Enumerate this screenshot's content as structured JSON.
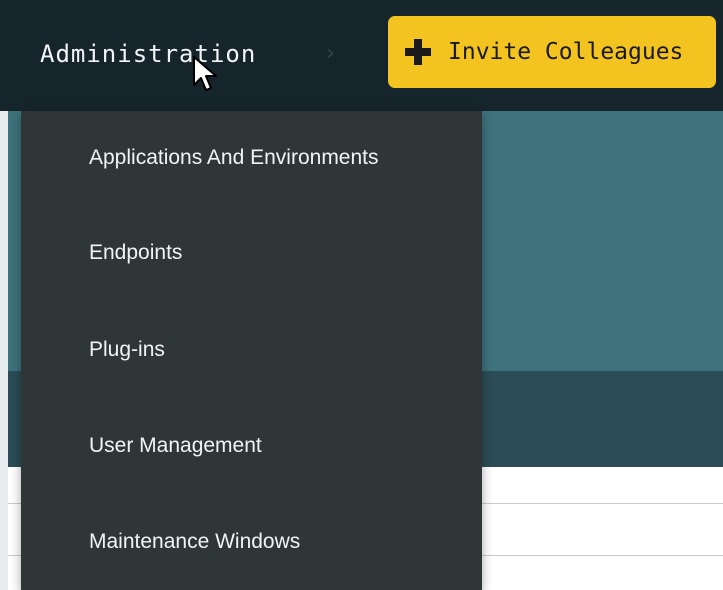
{
  "topbar": {
    "nav_label": "Administration",
    "chevron_icon": "chevron-right-icon",
    "invite_button": {
      "label": "Invite Colleagues",
      "icon": "plus-icon",
      "color": "#f3c31f"
    },
    "background_color": "#16242c"
  },
  "dropdown": {
    "items": [
      {
        "label": "Applications And Environments"
      },
      {
        "label": "Endpoints"
      },
      {
        "label": "Plug-ins"
      },
      {
        "label": "User Management"
      },
      {
        "label": "Maintenance Windows"
      }
    ],
    "background_color": "#2f3638"
  },
  "colors": {
    "teal_band": "#3e727c",
    "teal_dark_band": "#2c4c57"
  },
  "cursor_icon": "mouse-pointer-icon"
}
